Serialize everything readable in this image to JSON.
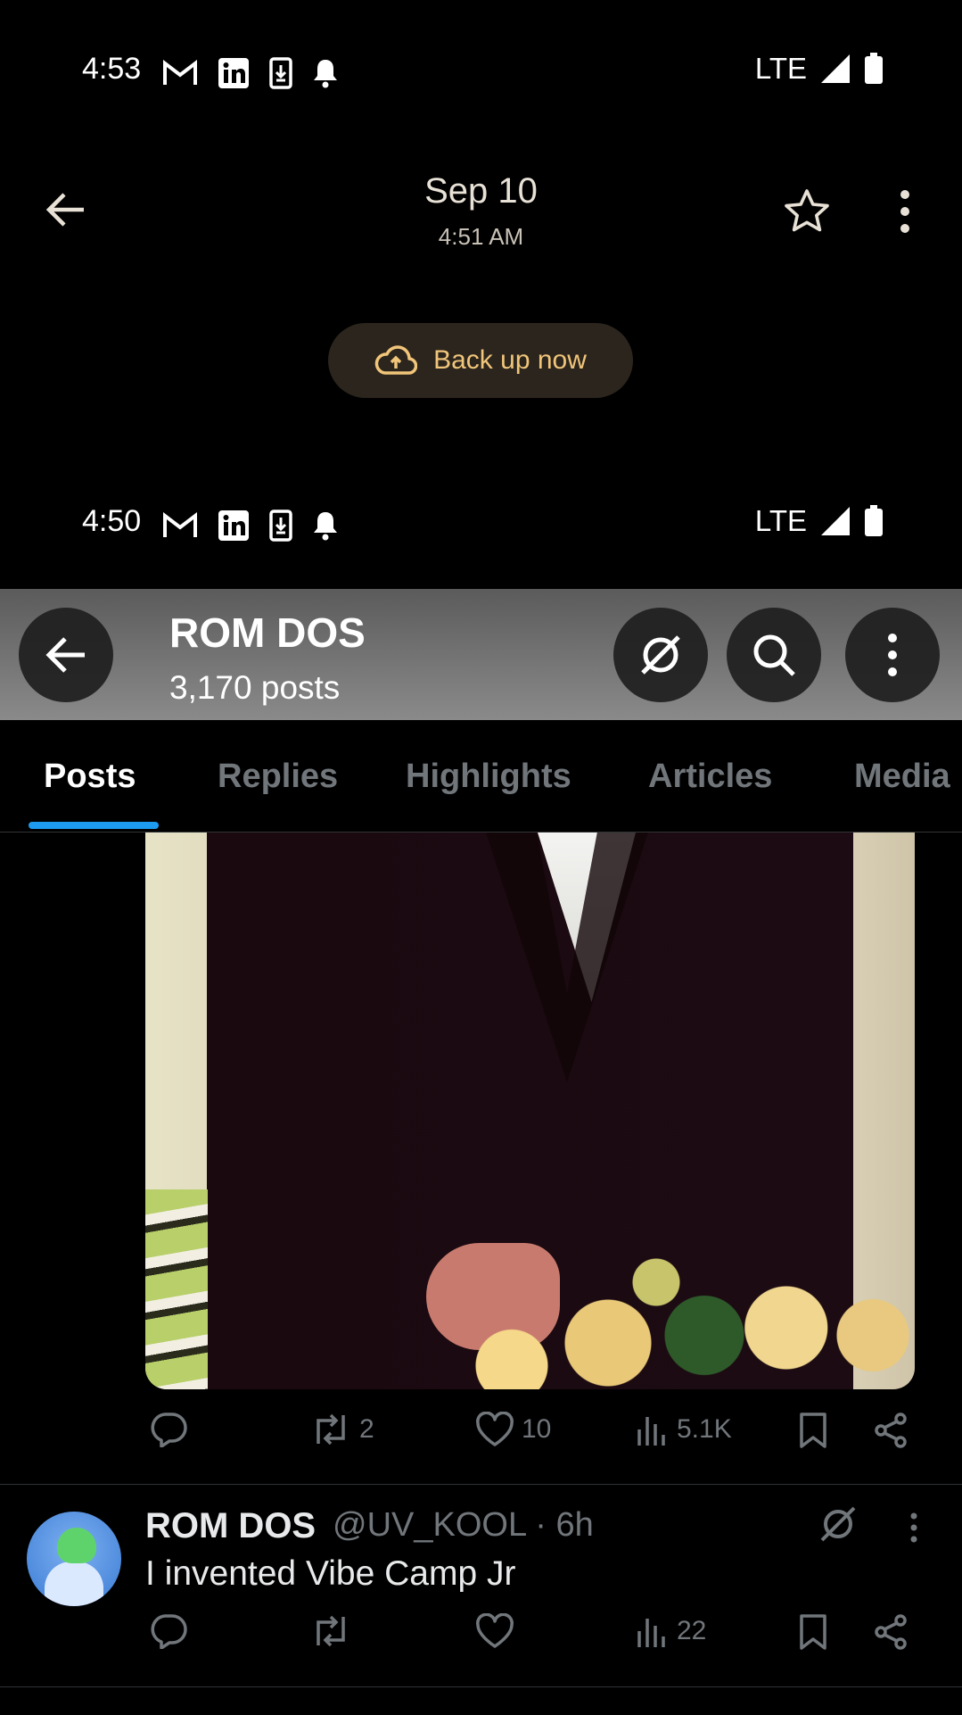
{
  "status_bar_top": {
    "time": "4:53",
    "network": "LTE"
  },
  "photos_header": {
    "date": "Sep 10",
    "time": "4:51 AM",
    "backup_label": "Back up now"
  },
  "status_bar_shot": {
    "time": "4:50",
    "network": "LTE"
  },
  "profile_header": {
    "name": "ROM DOS",
    "post_count": "3,170 posts"
  },
  "tabs": [
    {
      "label": "Posts",
      "active": true
    },
    {
      "label": "Replies",
      "active": false
    },
    {
      "label": "Highlights",
      "active": false
    },
    {
      "label": "Articles",
      "active": false
    },
    {
      "label": "Media",
      "active": false
    }
  ],
  "post1_actions": {
    "reposts": "2",
    "likes": "10",
    "views": "5.1K"
  },
  "post2": {
    "name": "ROM DOS",
    "handle": "@UV_KOOL · 6h",
    "text": "I invented Vibe Camp Jr",
    "reposts": "",
    "likes": "",
    "views": "22"
  },
  "colors": {
    "accent": "#1d9bf0",
    "muted": "#71767b",
    "backup_text": "#f1c57a"
  }
}
